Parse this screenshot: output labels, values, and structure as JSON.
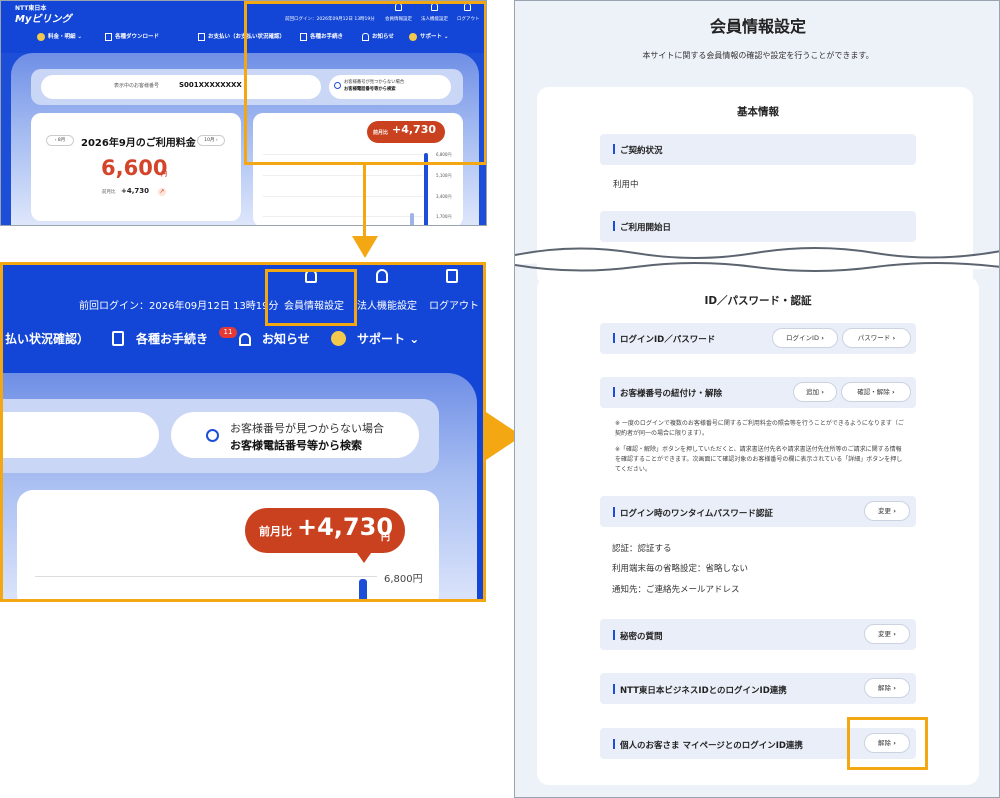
{
  "panel1": {
    "brand_small": "NTT東日本",
    "brand": "Myビリング",
    "last_login": "前回ログイン：2026年09月12日 13時19分",
    "header_links": [
      "会員情報設定",
      "法人機能設定",
      "ログアウト"
    ],
    "nav": [
      "料金・明細",
      "各種ダウンロード",
      "お支払い（お支払い状況確認）",
      "各種お手続き",
      "お知らせ",
      "サポート"
    ],
    "account_label": "表示中のお客様番号",
    "account_value": "S001XXXXXXXX",
    "search_line1": "お客様番号が見つからない場合",
    "search_line2": "お客様電話番号等から検索",
    "prev_month": "8月",
    "next_month": "10月",
    "usage_title": "2026年9月のご利用料金",
    "amount": "6,600",
    "amount_unit": "円",
    "diff_label": "前月比",
    "diff_value": "+4,730",
    "bubble_label": "前月比",
    "bubble_value": "+4,730",
    "ticks": [
      "6,800円",
      "5,100円",
      "3,400円",
      "1,700円"
    ]
  },
  "panel2": {
    "last_login": "前回ログイン：2026年09月12日 13時19分",
    "member_settings": "会員情報設定",
    "corporate_settings": "法人機能設定",
    "logout": "ログアウト",
    "nav_payment": "払い状況確認）",
    "nav_procedures": "各種お手続き",
    "notice_badge": "11",
    "nav_notice": "お知らせ",
    "nav_support": "サポート",
    "search_line1": "お客様番号が見つからない場合",
    "search_line2": "お客様電話番号等から検索",
    "bubble_label": "前月比",
    "bubble_value": "+4,730",
    "bubble_unit": "円",
    "tick": "6,800円"
  },
  "panel3": {
    "title": "会員情報設定",
    "description": "本サイトに関する会員情報の確認や設定を行うことができます。",
    "basic_info": "基本情報",
    "contract_status_label": "ご契約状況",
    "contract_status_value": "利用中",
    "start_date_label": "ご利用開始日",
    "id_section": "ID／パスワード・認証",
    "login_id_pw": "ログインID／パスワード",
    "btn_login_id": "ログインID",
    "btn_password": "パスワード",
    "link_customer": "お客様番号の紐付け・解除",
    "btn_add": "追加",
    "btn_confirm_release": "確認・解除",
    "note1": "※ 一度のログインで複数のお客様番号に関するご利用料金の照会等を行うことができるようになります（ご契約者が同一の場合に限ります）。",
    "note2": "※「確認・解除」ボタンを押していただくと、請求書送付先名や請求書送付先住所等のご請求に関する情報を確認することができます。次画面にて確認対象のお客様番号の欄に表示されている「詳細」ボタンを押してください。",
    "otp": "ログイン時のワンタイムパスワード認証",
    "btn_change": "変更",
    "otp_auth": "認証：認証する",
    "otp_skip": "利用端末毎の省略設定：省略しない",
    "otp_notify": "通知先：ご連絡先メールアドレス",
    "secret_q": "秘密の質問",
    "ntt_biz": "NTT東日本ビジネスIDとのログインID連携",
    "btn_release": "解除",
    "personal": "個人のお客さま マイページとのログインID連携"
  },
  "colors": {
    "brand_blue": "#1346d6",
    "accent_orange": "#f3a712",
    "amount_red": "#d4442a"
  }
}
